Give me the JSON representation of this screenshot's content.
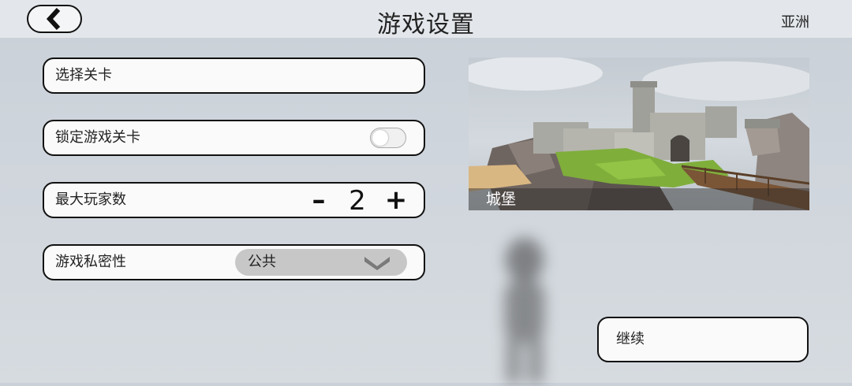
{
  "header": {
    "title": "游戏设置",
    "region": "亚洲",
    "back_icon": "chevron-left-icon"
  },
  "settings": {
    "select_level_label": "选择关卡",
    "lock_level_label": "锁定游戏关卡",
    "lock_level_enabled": false,
    "max_players_label": "最大玩家数",
    "max_players_minus": "–",
    "max_players_value": "2",
    "max_players_plus": "+",
    "privacy_label": "游戏私密性",
    "privacy_value": "公共",
    "privacy_dropdown_icon": "chevron-down-icon"
  },
  "preview": {
    "caption": "城堡"
  },
  "footer": {
    "continue_label": "继续"
  },
  "colors": {
    "background": "#cfd5dc",
    "topbar": "#e3e7eb",
    "border": "#111111",
    "select_bg": "#c7c7c7"
  }
}
